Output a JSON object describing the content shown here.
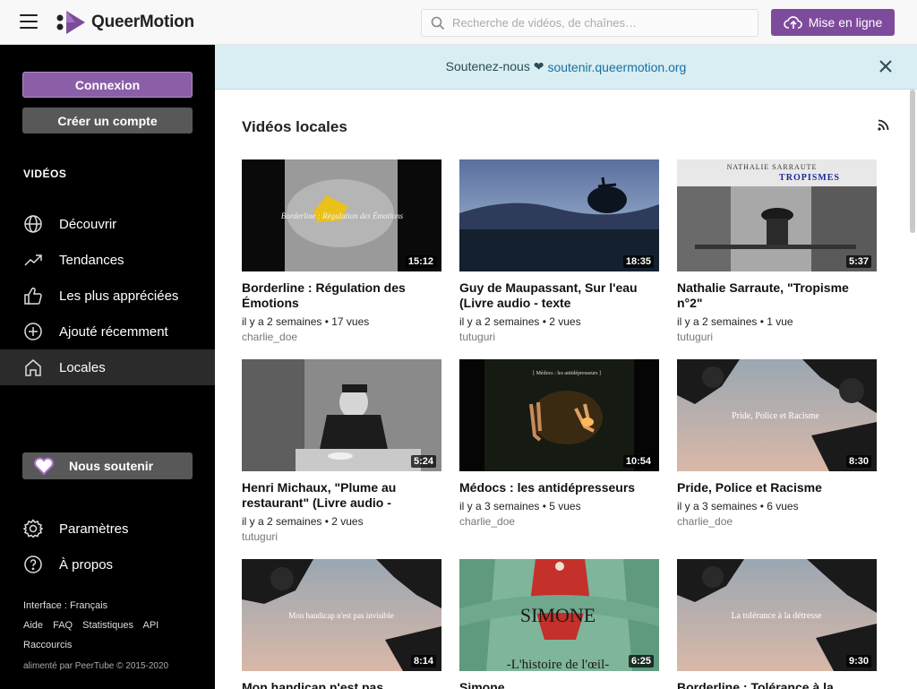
{
  "header": {
    "brand": "QueerMotion",
    "search_placeholder": "Recherche de vidéos, de chaînes…",
    "upload_label": "Mise en ligne",
    "accent": "#7e4b9c"
  },
  "sidebar": {
    "login_label": "Connexion",
    "create_label": "Créer un compte",
    "section_title": "VIDÉOS",
    "items": [
      {
        "label": "Découvrir",
        "icon": "globe-icon"
      },
      {
        "label": "Tendances",
        "icon": "trending-icon"
      },
      {
        "label": "Les plus appréciées",
        "icon": "thumbs-up-icon"
      },
      {
        "label": "Ajouté récemment",
        "icon": "plus-circle-icon"
      },
      {
        "label": "Locales",
        "icon": "home-icon"
      }
    ],
    "support_label": "Nous soutenir",
    "settings_label": "Paramètres",
    "about_label": "À propos",
    "interface": "Interface : Français",
    "links": [
      "Aide",
      "FAQ",
      "Statistiques",
      "API"
    ],
    "shortcuts": "Raccourcis",
    "powered": "alimenté par PeerTube © 2015-2020"
  },
  "banner": {
    "text": "Soutenez-nous ❤",
    "link": "soutenir.queermotion.org"
  },
  "main": {
    "title": "Vidéos locales",
    "videos": [
      {
        "title": "Borderline : Régulation des Émotions",
        "meta": "il y a 2 semaines • 17 vues",
        "channel": "charlie_doe",
        "duration": "15:12"
      },
      {
        "title": "Guy de Maupassant, Sur l'eau (Livre audio - texte",
        "meta": "il y a 2 semaines • 2 vues",
        "channel": "tutuguri",
        "duration": "18:35"
      },
      {
        "title": "Nathalie Sarraute, \"Tropisme n°2\"",
        "meta": "il y a 2 semaines • 1 vue",
        "channel": "tutuguri",
        "duration": "5:37"
      },
      {
        "title": "Henri Michaux, \"Plume au restaurant\" (Livre audio -",
        "meta": "il y a 2 semaines • 2 vues",
        "channel": "tutuguri",
        "duration": "5:24"
      },
      {
        "title": "Médocs : les antidépresseurs",
        "meta": "il y a 3 semaines • 5 vues",
        "channel": "charlie_doe",
        "duration": "10:54"
      },
      {
        "title": "Pride, Police et Racisme",
        "meta": "il y a 3 semaines • 6 vues",
        "channel": "charlie_doe",
        "duration": "8:30"
      },
      {
        "title": "Mon handicap n'est pas",
        "meta": "",
        "channel": "",
        "duration": "8:14"
      },
      {
        "title": "Simone",
        "meta": "",
        "channel": "",
        "duration": "6:25"
      },
      {
        "title": "Borderline : Tolérance à la",
        "meta": "",
        "channel": "",
        "duration": "9:30"
      }
    ],
    "thumb_texts": {
      "t0": "Borderline : Régulation des Émotions",
      "t2a": "NATHALIE SARRAUTE",
      "t2b": "TROPISMES",
      "t4": "[ Médocs : les antidépresseurs ]",
      "t5": "Pride, Police et Racisme",
      "t6": "Mon handicap n'est pas invisible",
      "t7a": "SIMONE",
      "t7b": "-L'histoire de l'œil-",
      "t8": "La tolérance à la détresse"
    }
  }
}
